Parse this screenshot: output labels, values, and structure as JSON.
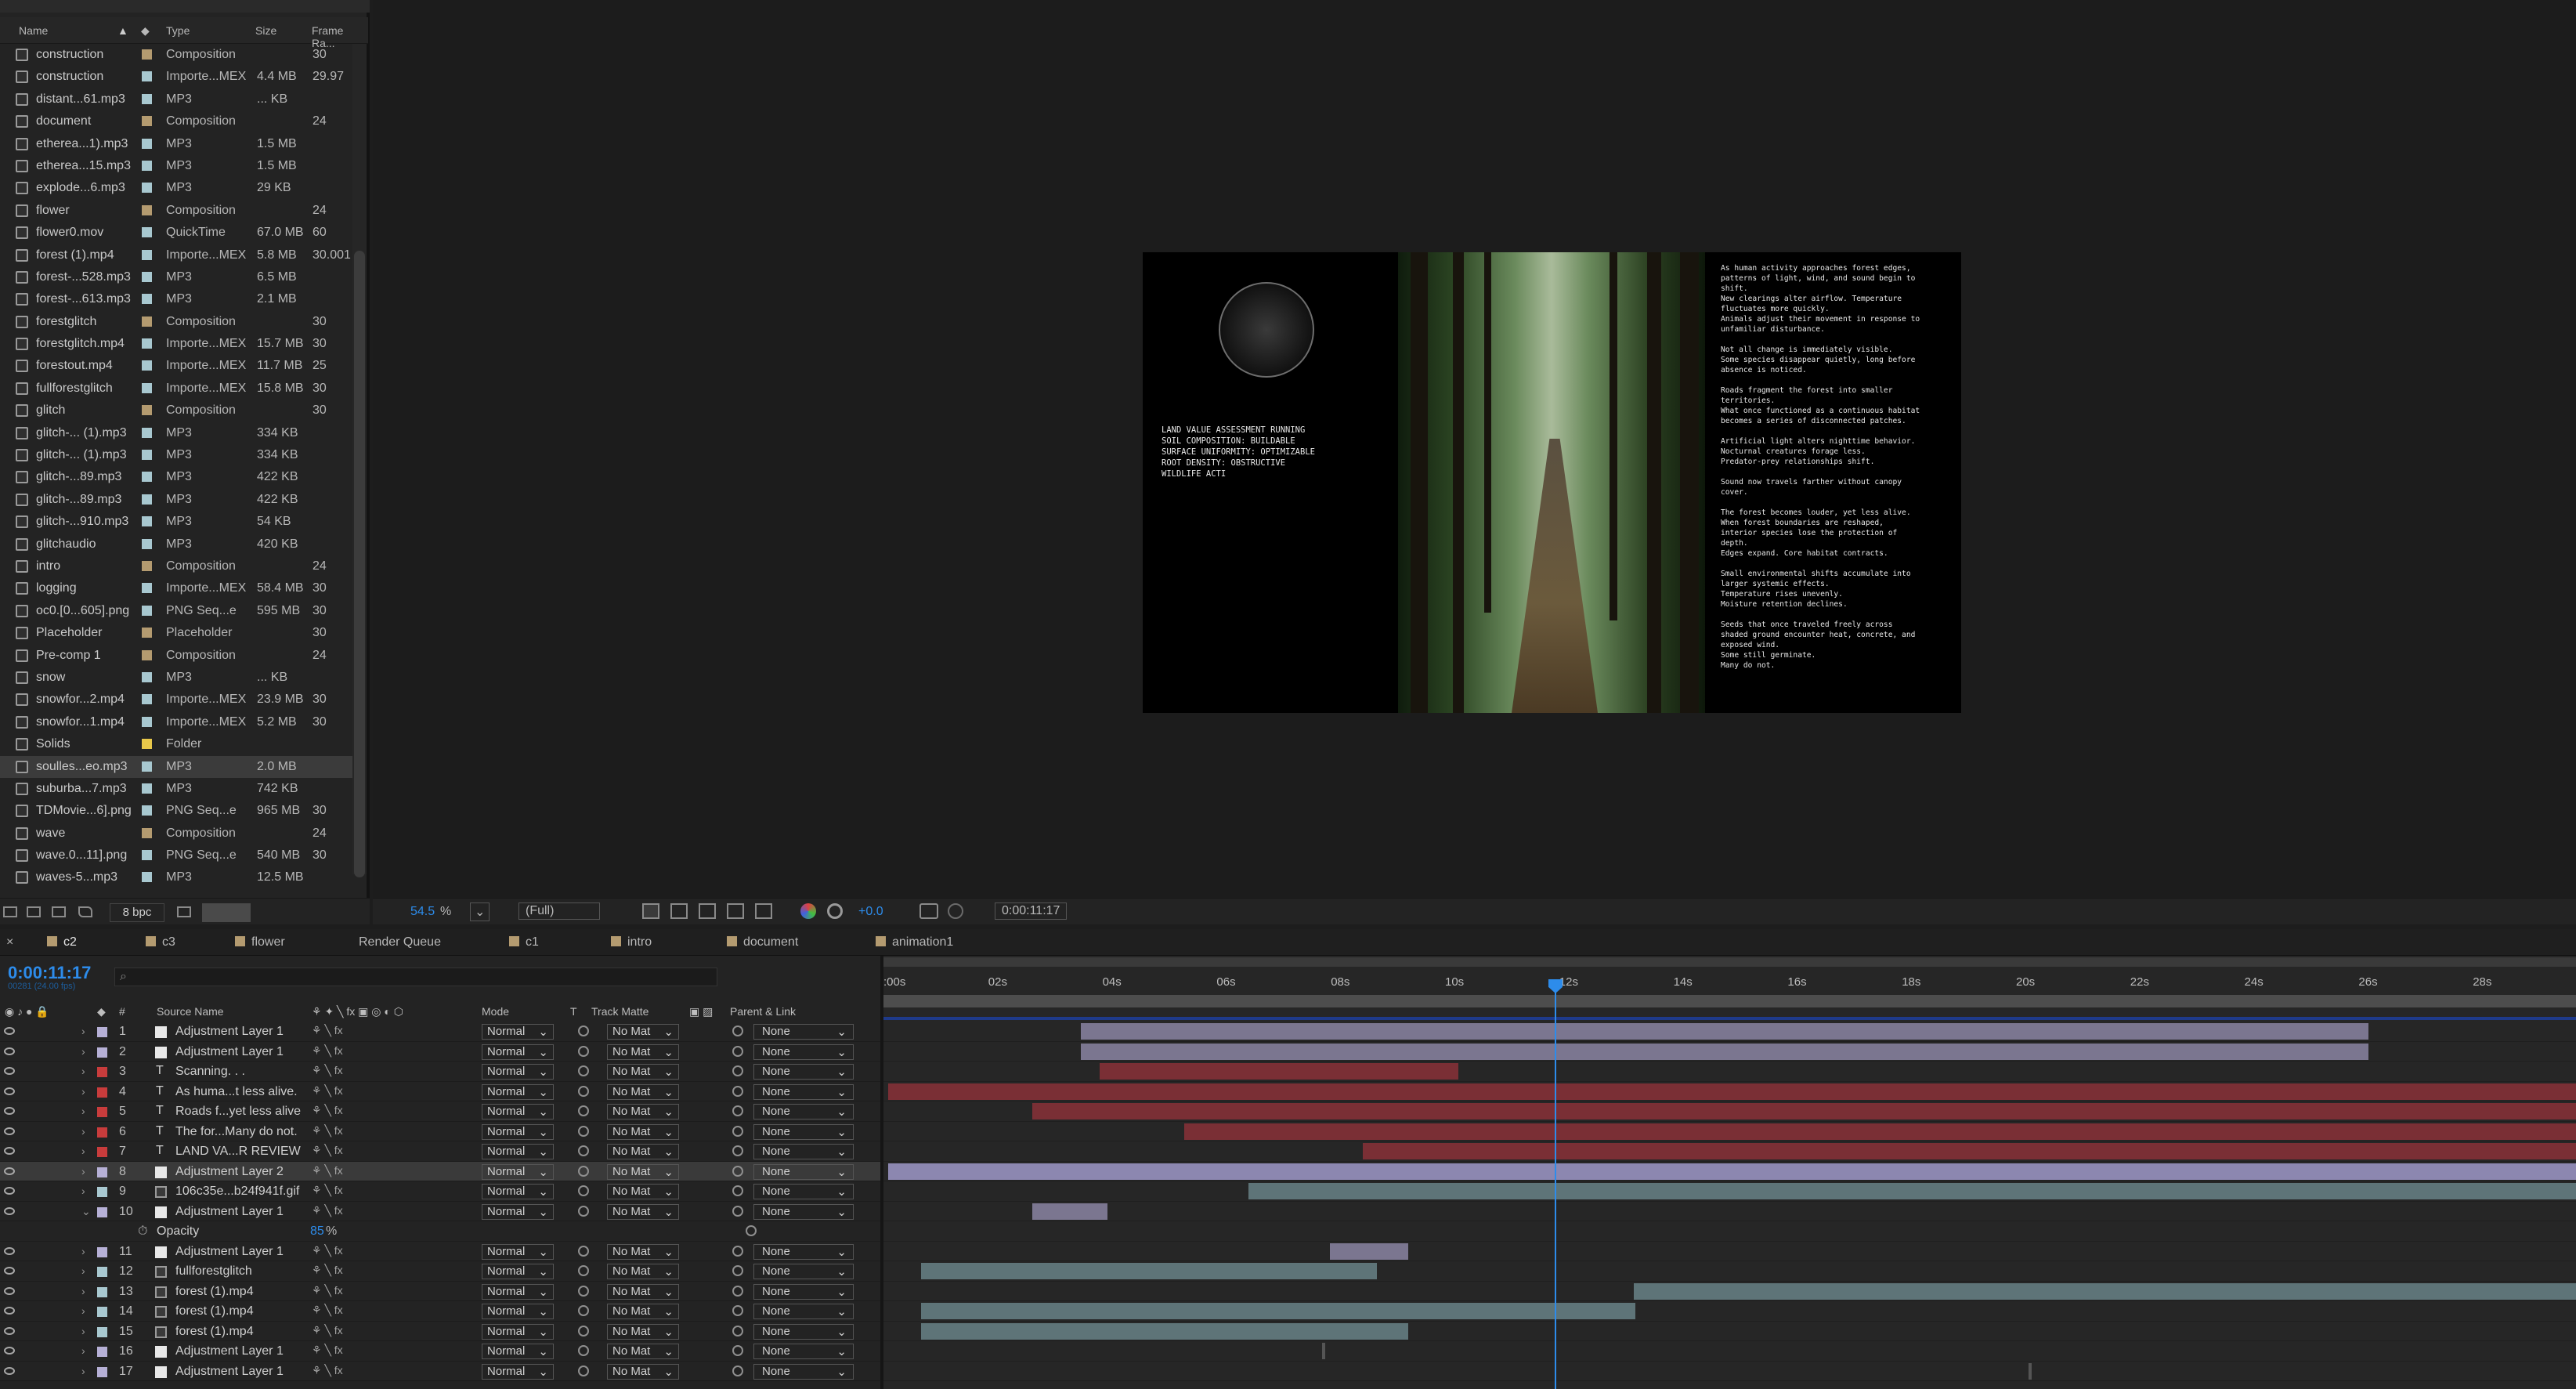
{
  "project": {
    "columns": {
      "name": "Name",
      "type": "Type",
      "size": "Size",
      "frame_rate": "Frame Ra..."
    },
    "items": [
      {
        "name": "construction",
        "type": "Composition",
        "size": "",
        "fps": "30",
        "color": "#b49b70"
      },
      {
        "name": "construction",
        "type": "Importe...MEX",
        "size": "4.4 MB",
        "fps": "29.97",
        "color": "#a8c8d0"
      },
      {
        "name": "distant...61.mp3",
        "type": "MP3",
        "size": "... KB",
        "fps": "",
        "color": "#a8c8d0"
      },
      {
        "name": "document",
        "type": "Composition",
        "size": "",
        "fps": "24",
        "color": "#b49b70"
      },
      {
        "name": "etherea...1).mp3",
        "type": "MP3",
        "size": "1.5 MB",
        "fps": "",
        "color": "#a8c8d0"
      },
      {
        "name": "etherea...15.mp3",
        "type": "MP3",
        "size": "1.5 MB",
        "fps": "",
        "color": "#a8c8d0"
      },
      {
        "name": "explode...6.mp3",
        "type": "MP3",
        "size": "29 KB",
        "fps": "",
        "color": "#a8c8d0"
      },
      {
        "name": "flower",
        "type": "Composition",
        "size": "",
        "fps": "24",
        "color": "#b49b70"
      },
      {
        "name": "flower0.mov",
        "type": "QuickTime",
        "size": "67.0 MB",
        "fps": "60",
        "color": "#a8c8d0"
      },
      {
        "name": "forest (1).mp4",
        "type": "Importe...MEX",
        "size": "5.8 MB",
        "fps": "30.001",
        "color": "#a8c8d0"
      },
      {
        "name": "forest-...528.mp3",
        "type": "MP3",
        "size": "6.5 MB",
        "fps": "",
        "color": "#a8c8d0"
      },
      {
        "name": "forest-...613.mp3",
        "type": "MP3",
        "size": "2.1 MB",
        "fps": "",
        "color": "#a8c8d0"
      },
      {
        "name": "forestglitch",
        "type": "Composition",
        "size": "",
        "fps": "30",
        "color": "#b49b70"
      },
      {
        "name": "forestglitch.mp4",
        "type": "Importe...MEX",
        "size": "15.7 MB",
        "fps": "30",
        "color": "#a8c8d0"
      },
      {
        "name": "forestout.mp4",
        "type": "Importe...MEX",
        "size": "11.7 MB",
        "fps": "25",
        "color": "#a8c8d0"
      },
      {
        "name": "fullforestglitch",
        "type": "Importe...MEX",
        "size": "15.8 MB",
        "fps": "30",
        "color": "#a8c8d0"
      },
      {
        "name": "glitch",
        "type": "Composition",
        "size": "",
        "fps": "30",
        "color": "#b49b70"
      },
      {
        "name": "glitch-... (1).mp3",
        "type": "MP3",
        "size": "334 KB",
        "fps": "",
        "color": "#a8c8d0"
      },
      {
        "name": "glitch-... (1).mp3",
        "type": "MP3",
        "size": "334 KB",
        "fps": "",
        "color": "#a8c8d0"
      },
      {
        "name": "glitch-...89.mp3",
        "type": "MP3",
        "size": "422 KB",
        "fps": "",
        "color": "#a8c8d0"
      },
      {
        "name": "glitch-...89.mp3",
        "type": "MP3",
        "size": "422 KB",
        "fps": "",
        "color": "#a8c8d0"
      },
      {
        "name": "glitch-...910.mp3",
        "type": "MP3",
        "size": "54 KB",
        "fps": "",
        "color": "#a8c8d0"
      },
      {
        "name": "glitchaudio",
        "type": "MP3",
        "size": "420 KB",
        "fps": "",
        "color": "#a8c8d0"
      },
      {
        "name": "intro",
        "type": "Composition",
        "size": "",
        "fps": "24",
        "color": "#b49b70"
      },
      {
        "name": "logging",
        "type": "Importe...MEX",
        "size": "58.4 MB",
        "fps": "30",
        "color": "#a8c8d0"
      },
      {
        "name": "oc0.[0...605].png",
        "type": "PNG Seq...e",
        "size": "595 MB",
        "fps": "30",
        "color": "#a8c8d0"
      },
      {
        "name": "Placeholder",
        "type": "Placeholder",
        "size": "",
        "fps": "30",
        "color": "#b49b70"
      },
      {
        "name": "Pre-comp 1",
        "type": "Composition",
        "size": "",
        "fps": "24",
        "color": "#b49b70"
      },
      {
        "name": "snow",
        "type": "MP3",
        "size": "... KB",
        "fps": "",
        "color": "#a8c8d0"
      },
      {
        "name": "snowfor...2.mp4",
        "type": "Importe...MEX",
        "size": "23.9 MB",
        "fps": "30",
        "color": "#a8c8d0"
      },
      {
        "name": "snowfor...1.mp4",
        "type": "Importe...MEX",
        "size": "5.2 MB",
        "fps": "30",
        "color": "#a8c8d0"
      },
      {
        "name": "Solids",
        "type": "Folder",
        "size": "",
        "fps": "",
        "color": "#e8c84a"
      },
      {
        "name": "soulles...eo.mp3",
        "type": "MP3",
        "size": "2.0 MB",
        "fps": "",
        "color": "#a8c8d0",
        "selected": true
      },
      {
        "name": "suburba...7.mp3",
        "type": "MP3",
        "size": "742 KB",
        "fps": "",
        "color": "#a8c8d0"
      },
      {
        "name": "TDMovie...6].png",
        "type": "PNG Seq...e",
        "size": "965 MB",
        "fps": "30",
        "color": "#a8c8d0"
      },
      {
        "name": "wave",
        "type": "Composition",
        "size": "",
        "fps": "24",
        "color": "#b49b70"
      },
      {
        "name": "wave.0...11].png",
        "type": "PNG Seq...e",
        "size": "540 MB",
        "fps": "30",
        "color": "#a8c8d0"
      },
      {
        "name": "waves-5...mp3",
        "type": "MP3",
        "size": "12.5 MB",
        "fps": "",
        "color": "#a8c8d0"
      }
    ],
    "footer": {
      "bpc": "8 bpc"
    }
  },
  "viewer": {
    "zoom": "54.5",
    "zoom_unit": "%",
    "resolution": "(Full)",
    "exposure": "+0.0",
    "timecode": "0:00:11:17",
    "left_text": "LAND VALUE ASSESSMENT RUNNING\nSOIL COMPOSITION: BUILDABLE\nSURFACE UNIFORMITY: OPTIMIZABLE\nROOT DENSITY: OBSTRUCTIVE\nWILDLIFE ACTI",
    "right_text": "As human activity approaches forest edges,\npatterns of light, wind, and sound begin to\nshift.\nNew clearings alter airflow. Temperature\nfluctuates more quickly.\nAnimals adjust their movement in response to\nunfamiliar disturbance.\n\nNot all change is immediately visible.\nSome species disappear quietly, long before\nabsence is noticed.\n\nRoads fragment the forest into smaller\nterritories.\nWhat once functioned as a continuous habitat\nbecomes a series of disconnected patches.\n\nArtificial light alters nighttime behavior.\nNocturnal creatures forage less.\nPredator-prey relationships shift.\n\nSound now travels farther without canopy\ncover.\n\nThe forest becomes louder, yet less alive.\nWhen forest boundaries are reshaped,\ninterior species lose the protection of\ndepth.\nEdges expand. Core habitat contracts.\n\nSmall environmental shifts accumulate into\nlarger systemic effects.\nTemperature rises unevenly.\nMoisture retention declines.\n\nSeeds that once traveled freely across\nshaded ground encounter heat, concrete, and\nexposed wind.\nSome still germinate.\nMany do not."
  },
  "tabs": [
    {
      "label": "c2",
      "color": "#b49b70",
      "active": true
    },
    {
      "label": "c3",
      "color": "#b49b70"
    },
    {
      "label": "flower",
      "color": "#b49b70"
    },
    {
      "label": "Render Queue",
      "color": ""
    },
    {
      "label": "c1",
      "color": "#b49b70"
    },
    {
      "label": "intro",
      "color": "#b49b70"
    },
    {
      "label": "document",
      "color": "#b49b70"
    },
    {
      "label": "animation1",
      "color": "#b49b70"
    }
  ],
  "timeline": {
    "timecode": "0:00:11:17",
    "frames": "00281 (24.00 fps)",
    "columns": {
      "num": "#",
      "source_name": "Source Name",
      "mode": "Mode",
      "t": "T",
      "track_matte": "Track Matte",
      "parent": "Parent & Link"
    },
    "ruler": [
      ":00s",
      "02s",
      "04s",
      "06s",
      "08s",
      "10s",
      "12s",
      "14s",
      "16s",
      "18s",
      "20s",
      "22s",
      "24s",
      "26s",
      "28s"
    ],
    "layers": [
      {
        "num": "1",
        "name": "Adjustment Layer 1",
        "type": "adj",
        "color": "#b6b0d6",
        "mode": "Normal",
        "matte": "No Mat",
        "parent": "None"
      },
      {
        "num": "2",
        "name": "Adjustment Layer 1",
        "type": "adj",
        "color": "#b6b0d6",
        "mode": "Normal",
        "matte": "No Mat",
        "parent": "None"
      },
      {
        "num": "3",
        "name": "Scanning. . .",
        "type": "text",
        "color": "#c83c3c",
        "mode": "Normal",
        "matte": "No Mat",
        "parent": "None"
      },
      {
        "num": "4",
        "name": "As huma...t less alive.",
        "type": "text",
        "color": "#c83c3c",
        "mode": "Normal",
        "matte": "No Mat",
        "parent": "None"
      },
      {
        "num": "5",
        "name": "Roads f...yet less alive.",
        "type": "text",
        "color": "#c83c3c",
        "mode": "Normal",
        "matte": "No Mat",
        "parent": "None"
      },
      {
        "num": "6",
        "name": "The for...Many do not.",
        "type": "text",
        "color": "#c83c3c",
        "mode": "Normal",
        "matte": "No Mat",
        "parent": "None"
      },
      {
        "num": "7",
        "name": "LAND VA...R REVIEW",
        "type": "text",
        "color": "#c83c3c",
        "mode": "Normal",
        "matte": "No Mat",
        "parent": "None"
      },
      {
        "num": "8",
        "name": "Adjustment Layer 2",
        "type": "adj",
        "color": "#b6b0d6",
        "mode": "Normal",
        "matte": "No Mat",
        "parent": "None",
        "selected": true
      },
      {
        "num": "9",
        "name": "106c35e...b24f941f.gif",
        "type": "footage",
        "color": "#a8c8d0",
        "mode": "Normal",
        "matte": "No Mat",
        "parent": "None"
      },
      {
        "num": "10",
        "name": "Adjustment Layer 1",
        "type": "adj",
        "color": "#b6b0d6",
        "mode": "Normal",
        "matte": "No Mat",
        "parent": "None",
        "expanded": true
      },
      {
        "num": "",
        "name": "Opacity",
        "type": "prop",
        "value": "85",
        "unit": "%"
      },
      {
        "num": "11",
        "name": "Adjustment Layer 1",
        "type": "adj",
        "color": "#b6b0d6",
        "mode": "Normal",
        "matte": "No Mat",
        "parent": "None"
      },
      {
        "num": "12",
        "name": "fullforestglitch",
        "type": "footage",
        "color": "#a8c8d0",
        "mode": "Normal",
        "matte": "No Mat",
        "parent": "None"
      },
      {
        "num": "13",
        "name": "forest (1).mp4",
        "type": "footage",
        "color": "#a8c8d0",
        "mode": "Normal",
        "matte": "No Mat",
        "parent": "None"
      },
      {
        "num": "14",
        "name": "forest (1).mp4",
        "type": "footage",
        "color": "#a8c8d0",
        "mode": "Normal",
        "matte": "No Mat",
        "parent": "None"
      },
      {
        "num": "15",
        "name": "forest (1).mp4",
        "type": "footage",
        "color": "#a8c8d0",
        "mode": "Normal",
        "matte": "No Mat",
        "parent": "None"
      },
      {
        "num": "16",
        "name": "Adjustment Layer 1",
        "type": "adj",
        "color": "#b6b0d6",
        "mode": "Normal",
        "matte": "No Mat",
        "parent": "None"
      },
      {
        "num": "17",
        "name": "Adjustment Layer 1",
        "type": "adj",
        "color": "#b6b0d6",
        "mode": "Normal",
        "matte": "No Mat",
        "parent": "None"
      }
    ]
  }
}
